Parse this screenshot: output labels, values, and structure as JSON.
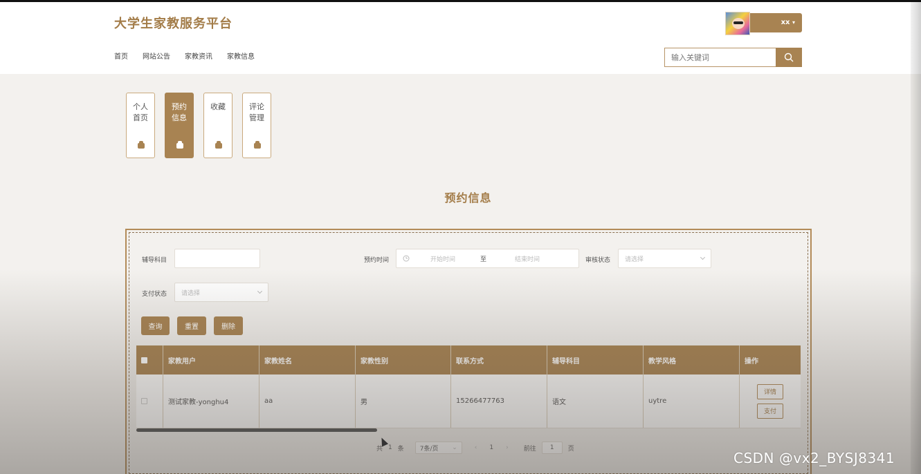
{
  "header": {
    "site_title": "大学生家教服务平台",
    "nav": [
      "首页",
      "网站公告",
      "家教资讯",
      "家教信息"
    ],
    "user_name": "xx",
    "search_placeholder": "输入关键词"
  },
  "tiles": [
    {
      "label": "个人首页",
      "line1": "个人",
      "line2": "首页",
      "active": false
    },
    {
      "label": "预约信息",
      "line1": "预约",
      "line2": "信息",
      "active": true
    },
    {
      "label": "收藏",
      "line1": "收藏",
      "line2": "",
      "active": false
    },
    {
      "label": "评论管理",
      "line1": "评论",
      "line2": "管理",
      "active": false
    }
  ],
  "page_heading": "预约信息",
  "filters": {
    "subject_label": "辅导科目",
    "time_label": "预约时间",
    "time_start_placeholder": "开始时间",
    "time_separator": "至",
    "time_end_placeholder": "结束时间",
    "audit_label": "审核状态",
    "audit_placeholder": "请选择",
    "pay_label": "支付状态",
    "pay_placeholder": "请选择"
  },
  "actions": {
    "query": "查询",
    "reset": "重置",
    "delete": "删除"
  },
  "table": {
    "columns": [
      "家教用户",
      "家教姓名",
      "家教性别",
      "联系方式",
      "辅导科目",
      "教学风格",
      "操作"
    ],
    "rows": [
      {
        "user": "测试家教-yonghu4",
        "name": "aa",
        "gender": "男",
        "phone": "15266477763",
        "subject": "语文",
        "style": "uytre",
        "op_detail": "详情",
        "op_pay": "支付"
      }
    ]
  },
  "pagination": {
    "total_prefix": "共",
    "total_count": "1",
    "total_suffix": "条",
    "page_size": "7条/页",
    "current_page": "1",
    "goto_label": "前往",
    "goto_value": "1",
    "goto_suffix": "页"
  },
  "watermark": "CSDN @vx2_BYSJ8341",
  "colors": {
    "accent": "#a88352",
    "title": "#a37c48"
  }
}
